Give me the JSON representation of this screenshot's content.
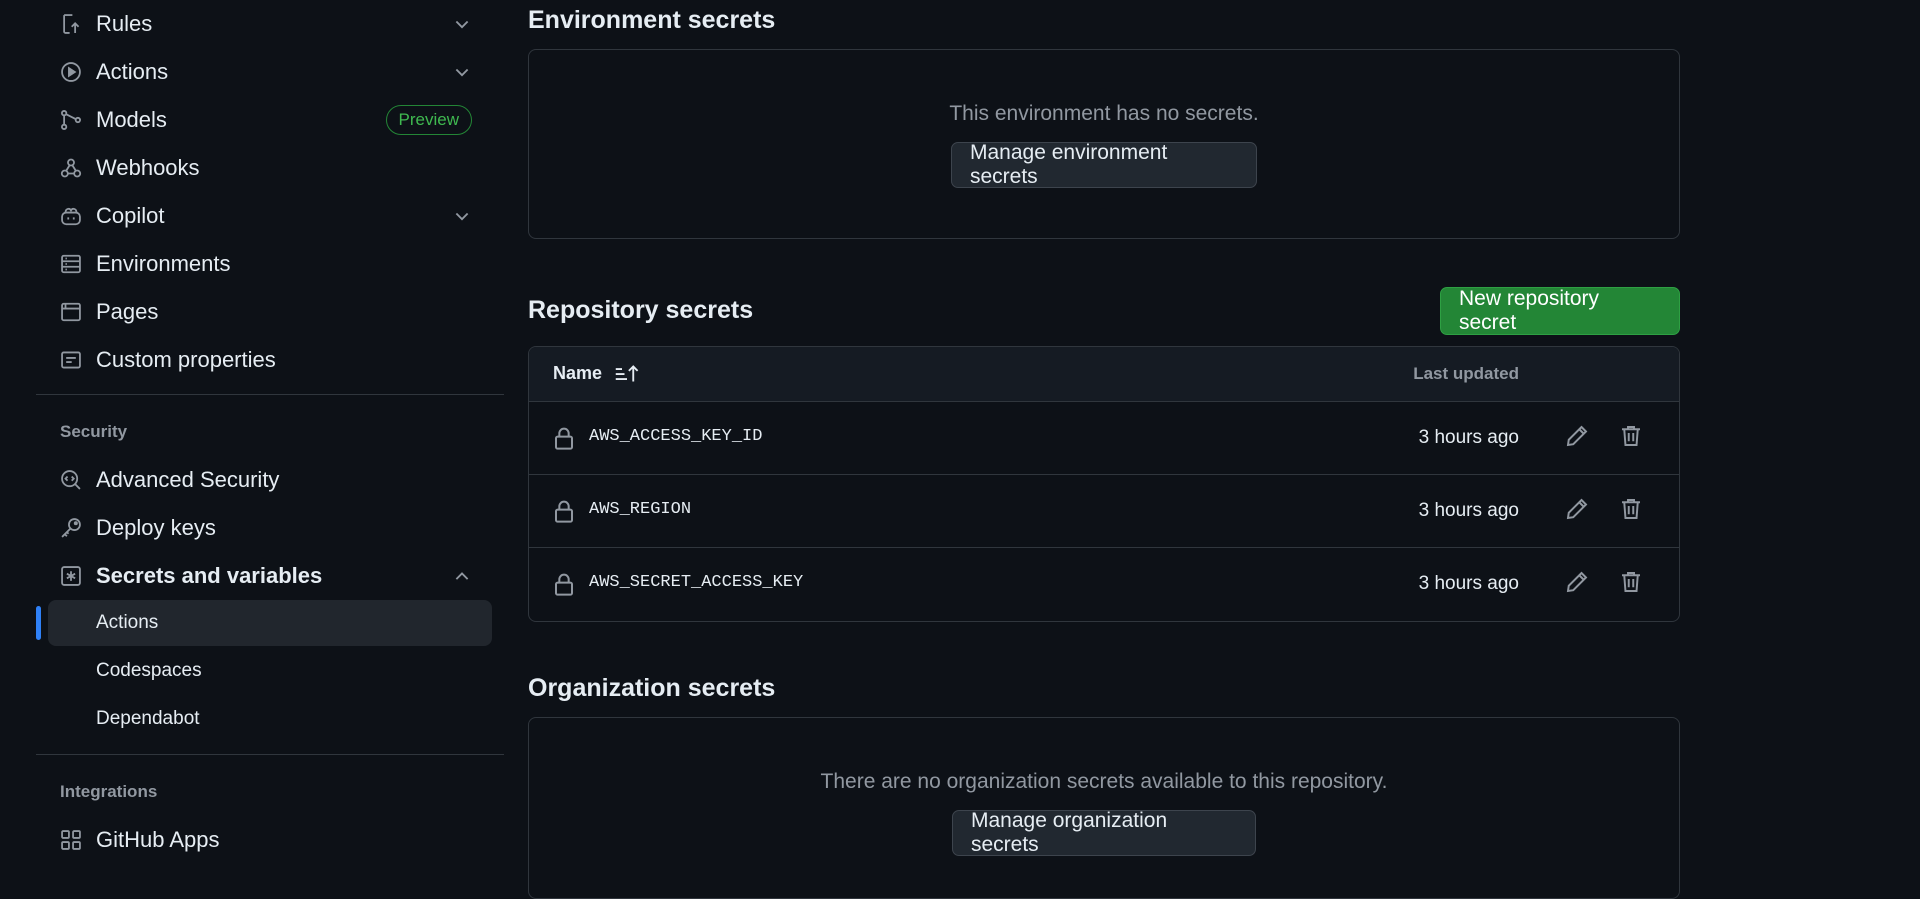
{
  "sidebar": {
    "items": [
      {
        "label": "Rules",
        "icon": "rules-icon",
        "chevron": "chevron-down"
      },
      {
        "label": "Actions",
        "icon": "play-icon",
        "chevron": "chevron-down"
      },
      {
        "label": "Models",
        "icon": "models-icon",
        "badge": "Preview"
      },
      {
        "label": "Webhooks",
        "icon": "webhook-icon"
      },
      {
        "label": "Copilot",
        "icon": "copilot-icon",
        "chevron": "chevron-down"
      },
      {
        "label": "Environments",
        "icon": "server-icon"
      },
      {
        "label": "Pages",
        "icon": "browser-icon"
      },
      {
        "label": "Custom properties",
        "icon": "note-icon"
      }
    ],
    "security_heading": "Security",
    "security_items": [
      {
        "label": "Advanced Security",
        "icon": "codescan-icon"
      },
      {
        "label": "Deploy keys",
        "icon": "key-icon"
      },
      {
        "label": "Secrets and variables",
        "icon": "asterisk-icon",
        "chevron": "chevron-up"
      }
    ],
    "sub_items": [
      {
        "label": "Actions",
        "active": true
      },
      {
        "label": "Codespaces"
      },
      {
        "label": "Dependabot"
      }
    ],
    "integrations_heading": "Integrations",
    "integrations_items": [
      {
        "label": "GitHub Apps",
        "icon": "apps-icon"
      }
    ]
  },
  "environment_secrets": {
    "title": "Environment secrets",
    "empty_text": "This environment has no secrets.",
    "button": "Manage environment secrets"
  },
  "repository_secrets": {
    "title": "Repository secrets",
    "new_button": "New repository secret",
    "col_name": "Name",
    "col_updated": "Last updated",
    "rows": [
      {
        "name": "AWS_ACCESS_KEY_ID",
        "updated": "3 hours ago"
      },
      {
        "name": "AWS_REGION",
        "updated": "3 hours ago"
      },
      {
        "name": "AWS_SECRET_ACCESS_KEY",
        "updated": "3 hours ago"
      }
    ]
  },
  "organization_secrets": {
    "title": "Organization secrets",
    "empty_text": "There are no organization secrets available to this repository.",
    "button": "Manage organization secrets"
  },
  "colors": {
    "background": "#0d1117",
    "primary_button": "#238636",
    "active_indicator": "#2f81f7",
    "preview_badge": "#3fb950"
  }
}
